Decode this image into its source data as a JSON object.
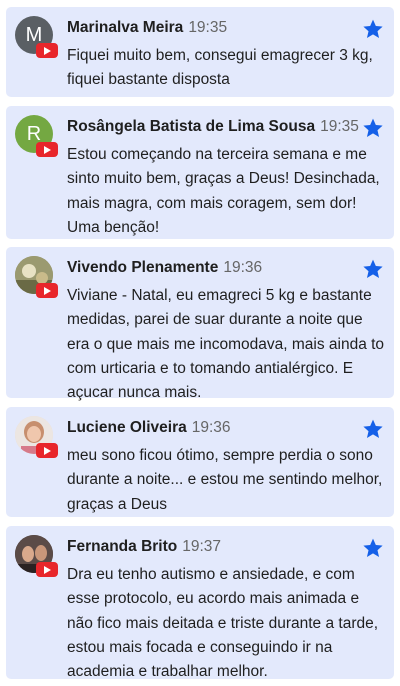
{
  "colors": {
    "card_bg": "#e3e9fc",
    "star": "#1560e8",
    "youtube_badge": "#e8262b"
  },
  "comments": [
    {
      "name": "Marinalva Meira",
      "time": "19:35",
      "avatar_letter": "M",
      "avatar_color": "#5a5f64",
      "starred": true,
      "text": "Fiquei muito bem, consegui emagrecer 3 kg, fiquei bastante disposta"
    },
    {
      "name": "Rosângela Batista de Lima Sousa",
      "time": "19:35",
      "avatar_letter": "R",
      "avatar_color": "#74a842",
      "starred": true,
      "text": "Estou começando na terceira semana e me sinto muito bem, graças a Deus! Desinchada, mais magra, com mais coragem, sem dor! Uma benção!"
    },
    {
      "name": "Vivendo Plenamente",
      "time": "19:36",
      "avatar_letter": "",
      "avatar_color": "#8c8a63",
      "starred": true,
      "text": "Viviane - Natal, eu emagreci 5 kg e bastante medidas, parei de suar durante a noite que era o que mais me incomodava, mais ainda to com urticaria e to tomando antialérgico. E açucar nunca mais."
    },
    {
      "name": "Luciene Oliveira",
      "time": "19:36",
      "avatar_letter": "",
      "avatar_color": "#c9a08f",
      "starred": true,
      "text": "meu sono ficou ótimo, sempre perdia o sono durante a noite... e estou me sentindo melhor, graças a Deus"
    },
    {
      "name": "Fernanda Brito",
      "time": "19:37",
      "avatar_letter": "",
      "avatar_color": "#3c3433",
      "starred": true,
      "text": "Dra eu tenho autismo e ansiedade, e com esse protocolo, eu acordo mais animada e não fico mais deitada e triste durante a tarde, estou mais focada e conseguindo ir na academia e trabalhar melhor."
    }
  ]
}
